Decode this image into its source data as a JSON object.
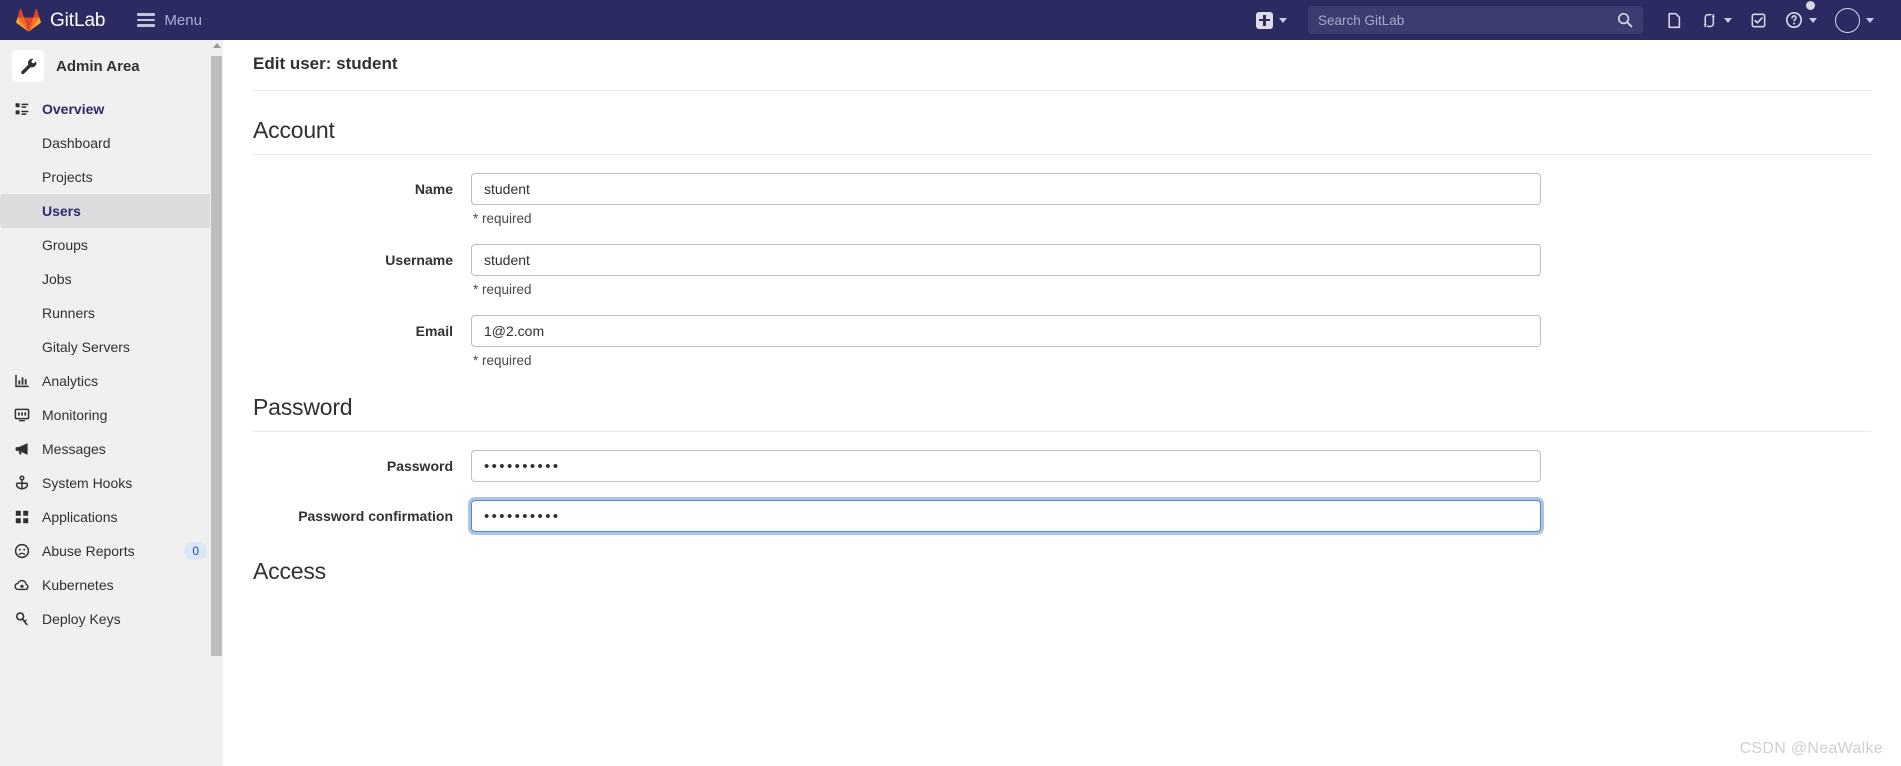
{
  "navbar": {
    "brand": "GitLab",
    "menu_label": "Menu",
    "new_label": "+",
    "search": {
      "placeholder": "Search GitLab",
      "value": ""
    },
    "icons": [
      "issues-icon",
      "merge-requests-icon",
      "todos-icon",
      "help-icon",
      "user-avatar"
    ],
    "background": "#2b2b61"
  },
  "sidebar": {
    "header": "Admin Area",
    "header_icon": "wrench-icon",
    "items": [
      {
        "label": "Overview",
        "icon": "overview-icon",
        "type": "section",
        "expanded": true
      },
      {
        "label": "Dashboard",
        "icon": "",
        "type": "sub",
        "active": false
      },
      {
        "label": "Projects",
        "icon": "",
        "type": "sub",
        "active": false
      },
      {
        "label": "Users",
        "icon": "",
        "type": "sub",
        "active": true
      },
      {
        "label": "Groups",
        "icon": "",
        "type": "sub",
        "active": false
      },
      {
        "label": "Jobs",
        "icon": "",
        "type": "sub",
        "active": false
      },
      {
        "label": "Runners",
        "icon": "",
        "type": "sub",
        "active": false
      },
      {
        "label": "Gitaly Servers",
        "icon": "",
        "type": "sub",
        "active": false
      },
      {
        "label": "Analytics",
        "icon": "analytics-icon",
        "type": "top"
      },
      {
        "label": "Monitoring",
        "icon": "monitoring-icon",
        "type": "top"
      },
      {
        "label": "Messages",
        "icon": "megaphone-icon",
        "type": "top"
      },
      {
        "label": "System Hooks",
        "icon": "hook-icon",
        "type": "top"
      },
      {
        "label": "Applications",
        "icon": "applications-icon",
        "type": "top"
      },
      {
        "label": "Abuse Reports",
        "icon": "abuse-icon",
        "type": "top",
        "badge": "0"
      },
      {
        "label": "Kubernetes",
        "icon": "kubernetes-icon",
        "type": "top"
      },
      {
        "label": "Deploy Keys",
        "icon": "key-icon",
        "type": "top"
      }
    ],
    "accent": "#2f2a6b",
    "active_bg": "#dcdcdf",
    "badge_bg": "#dbe7f8"
  },
  "main": {
    "page_title": "Edit user: student",
    "sections": {
      "account": {
        "heading": "Account",
        "fields": [
          {
            "label": "Name",
            "value": "student",
            "note": "* required",
            "type": "text",
            "focused": false
          },
          {
            "label": "Username",
            "value": "student",
            "note": "* required",
            "type": "text",
            "focused": false
          },
          {
            "label": "Email",
            "value": "1@2.com",
            "note": "* required",
            "type": "text",
            "focused": false
          }
        ]
      },
      "password": {
        "heading": "Password",
        "fields": [
          {
            "label": "Password",
            "value": "••••••••••",
            "note": "",
            "type": "password",
            "focused": false
          },
          {
            "label": "Password confirmation",
            "value": "••••••••••",
            "note": "",
            "type": "password",
            "focused": true
          }
        ]
      },
      "access": {
        "heading": "Access"
      }
    }
  },
  "watermark": "CSDN @NeaWalke"
}
